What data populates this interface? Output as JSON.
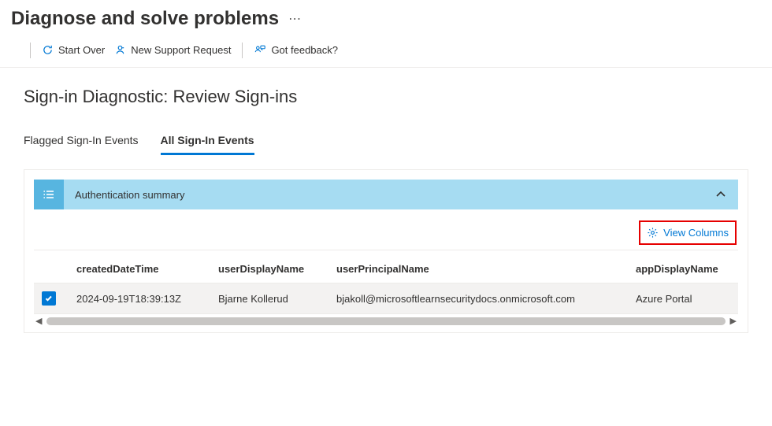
{
  "header": {
    "title": "Diagnose and solve problems"
  },
  "toolbar": {
    "start_over": "Start Over",
    "new_support_request": "New Support Request",
    "got_feedback": "Got feedback?"
  },
  "section": {
    "title": "Sign-in Diagnostic: Review Sign-ins"
  },
  "tabs": {
    "flagged": "Flagged Sign-In Events",
    "all": "All Sign-In Events"
  },
  "summary": {
    "label": "Authentication summary"
  },
  "actions": {
    "view_columns": "View Columns"
  },
  "table": {
    "headers": {
      "created": "createdDateTime",
      "user_display": "userDisplayName",
      "user_principal": "userPrincipalName",
      "app_display": "appDisplayName"
    },
    "rows": [
      {
        "checked": true,
        "created": "2024-09-19T18:39:13Z",
        "user_display": "Bjarne Kollerud",
        "user_principal": "bjakoll@microsoftlearnsecuritydocs.onmicrosoft.com",
        "app_display": "Azure Portal"
      }
    ]
  }
}
